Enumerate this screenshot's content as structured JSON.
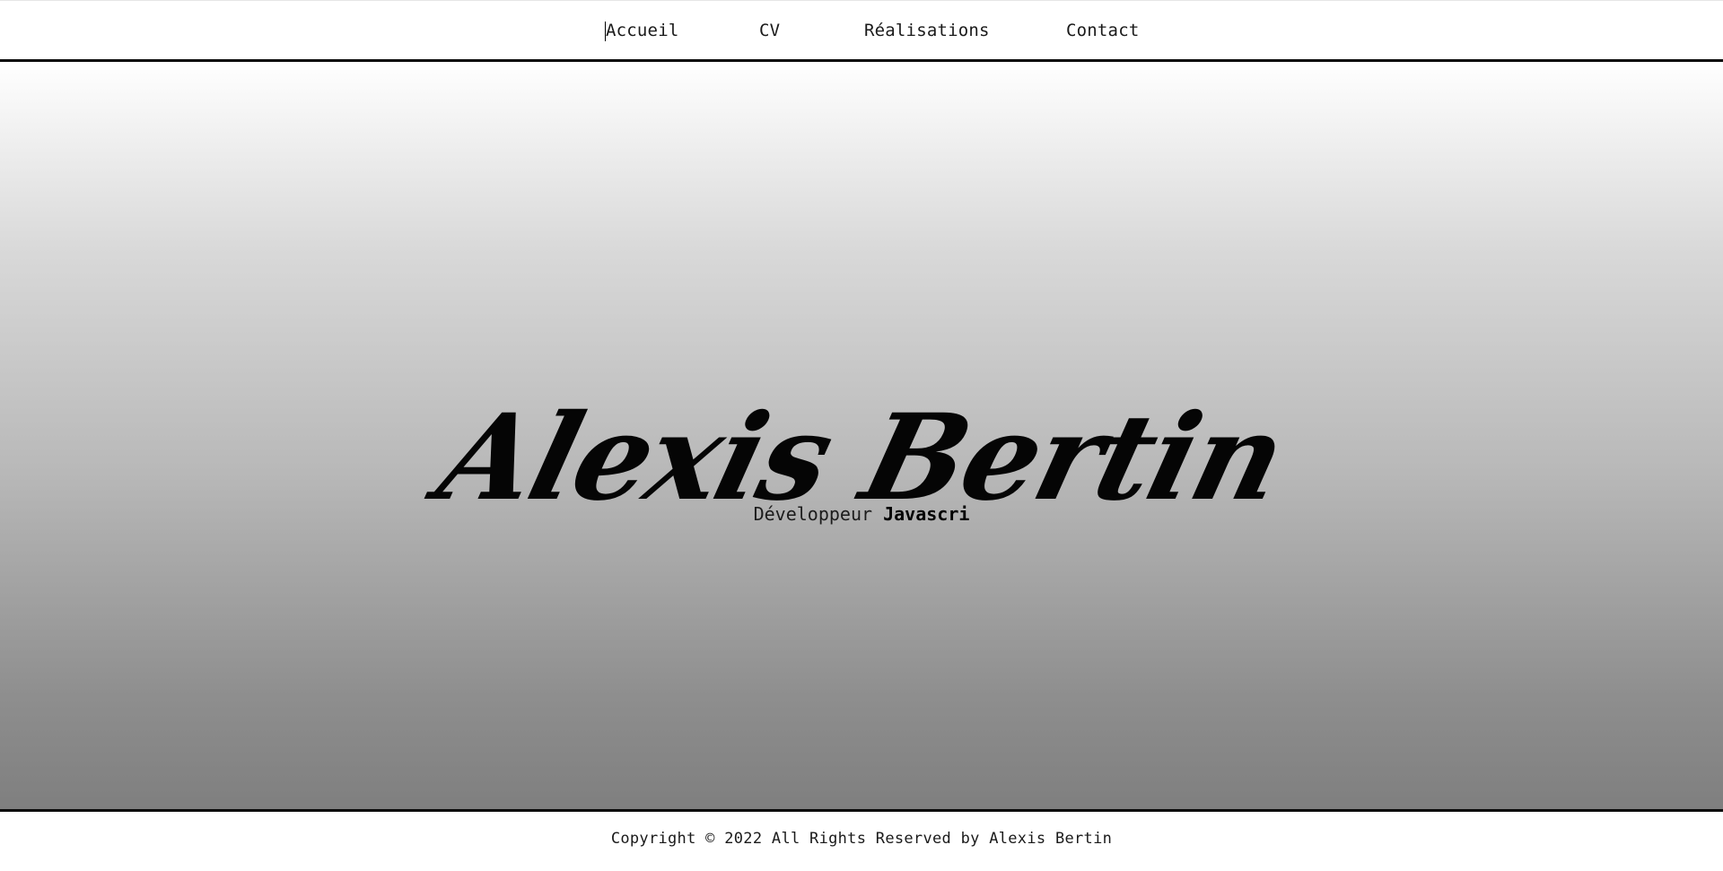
{
  "nav": {
    "items": [
      {
        "label": "Accueil",
        "active": true
      },
      {
        "label": "CV",
        "active": false
      },
      {
        "label": "Réalisations",
        "active": false
      },
      {
        "label": "Contact",
        "active": false
      }
    ]
  },
  "hero": {
    "name": "Alexis Bertin",
    "subtitle_prefix": "Développeur",
    "subtitle_typed": "Javascri"
  },
  "footer": {
    "copyright": "Copyright © 2022 All Rights Reserved by Alexis Bertin"
  },
  "colors": {
    "text": "#000000",
    "border": "#0a0a0a",
    "gradient_top": "#ffffff",
    "gradient_bottom": "#7f7f7f"
  }
}
